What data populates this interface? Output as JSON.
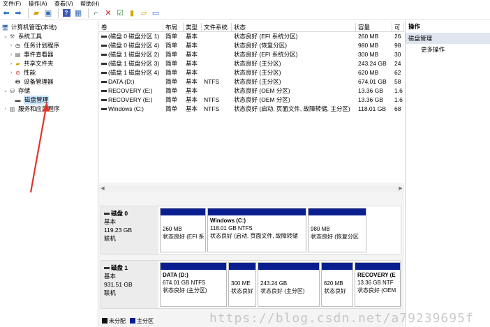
{
  "menubar": [
    "文件(F)",
    "操作(A)",
    "查看(V)",
    "帮助(H)"
  ],
  "toolbar": {
    "icons": [
      "back-icon",
      "forward-icon",
      "folder-up-icon",
      "show-hide-tree-icon",
      "help-icon",
      "properties-icon",
      "connect-icon",
      "delete-icon",
      "check-icon",
      "folder-icon",
      "folder-open-icon",
      "view-icon"
    ]
  },
  "tree": [
    {
      "label": "计算机管理(本地)",
      "level": 0,
      "icon": "computer-management-icon"
    },
    {
      "label": "系统工具",
      "level": 1,
      "icon": "tools-icon"
    },
    {
      "label": "任务计划程序",
      "level": 2,
      "icon": "clock-icon"
    },
    {
      "label": "事件查看器",
      "level": 2,
      "icon": "event-viewer-icon"
    },
    {
      "label": "共享文件夹",
      "level": 2,
      "icon": "shared-folder-icon"
    },
    {
      "label": "性能",
      "level": 2,
      "icon": "performance-icon"
    },
    {
      "label": "设备管理器",
      "level": 2,
      "icon": "device-manager-icon"
    },
    {
      "label": "存储",
      "level": 1,
      "icon": "storage-icon"
    },
    {
      "label": "磁盘管理",
      "level": 2,
      "icon": "disk-management-icon",
      "selected": true
    },
    {
      "label": "服务和应用程序",
      "level": 1,
      "icon": "services-icon"
    }
  ],
  "volume_table": {
    "headers": [
      "卷",
      "布局",
      "类型",
      "文件系统",
      "状态",
      "容量",
      "可"
    ],
    "rows": [
      [
        "(磁盘 0 磁盘分区 1)",
        "简单",
        "基本",
        "",
        "状态良好 (EFI 系统分区)",
        "260 MB",
        "26"
      ],
      [
        "(磁盘 0 磁盘分区 4)",
        "简单",
        "基本",
        "",
        "状态良好 (恢复分区)",
        "980 MB",
        "98"
      ],
      [
        "(磁盘 1 磁盘分区 2)",
        "简单",
        "基本",
        "",
        "状态良好 (EFI 系统分区)",
        "300 MB",
        "30"
      ],
      [
        "(磁盘 1 磁盘分区 3)",
        "简单",
        "基本",
        "",
        "状态良好 (主分区)",
        "243.24 GB",
        "24"
      ],
      [
        "(磁盘 1 磁盘分区 4)",
        "简单",
        "基本",
        "",
        "状态良好 (主分区)",
        "620 MB",
        "62"
      ],
      [
        "DATA (D:)",
        "简单",
        "基本",
        "NTFS",
        "状态良好 (主分区)",
        "674.01 GB",
        "58"
      ],
      [
        "RECOVERY (E:)",
        "简单",
        "基本",
        "",
        "状态良好 (OEM 分区)",
        "13.36 GB",
        "1.6"
      ],
      [
        "RECOVERY (E:)",
        "简单",
        "基本",
        "NTFS",
        "状态良好 (OEM 分区)",
        "13.36 GB",
        "1.6"
      ],
      [
        "Windows (C:)",
        "简单",
        "基本",
        "NTFS",
        "状态良好 (启动, 页面文件, 故障转储, 主分区)",
        "118.01 GB",
        "68"
      ]
    ]
  },
  "disks": [
    {
      "name": "磁盘 0",
      "type": "基本",
      "size": "119.23 GB",
      "status": "联机",
      "partitions": [
        {
          "name": "",
          "size": "260 MB",
          "status": "状态良好 (EFI 系"
        },
        {
          "name": "Windows (C:)",
          "size": "118.01 GB NTFS",
          "status": "状态良好 (启动, 页面文件, 故障转储"
        },
        {
          "name": "",
          "size": "980 MB",
          "status": "状态良好 (恢复分区"
        }
      ]
    },
    {
      "name": "磁盘 1",
      "type": "基本",
      "size": "931.51 GB",
      "status": "联机",
      "partitions": [
        {
          "name": "DATA (D:)",
          "size": "674.01 GB NTFS",
          "status": "状态良好 (主分区)"
        },
        {
          "name": "",
          "size": "300 ME",
          "status": "状态良好"
        },
        {
          "name": "",
          "size": "243.24 GB",
          "status": "状态良好 (主分区)"
        },
        {
          "name": "",
          "size": "620 MB",
          "status": "状态良好"
        },
        {
          "name": "RECOVERY (E",
          "size": "13.36 GB NTF",
          "status": "状态良好 (OEM"
        }
      ]
    }
  ],
  "legend": [
    {
      "label": "未分配",
      "color": "#111111"
    },
    {
      "label": "主分区",
      "color": "#0a1f8f"
    }
  ],
  "actions": {
    "header": "操作",
    "section": "磁盘管理",
    "items": [
      "更多操作"
    ]
  },
  "watermark": "https://blog.csdn.net/a79239695f",
  "colors": {
    "partition_bar": "#0a1f8f",
    "selection": "#cce8ff",
    "action_section": "#dfe6f0",
    "arrow": "#e0362a"
  }
}
